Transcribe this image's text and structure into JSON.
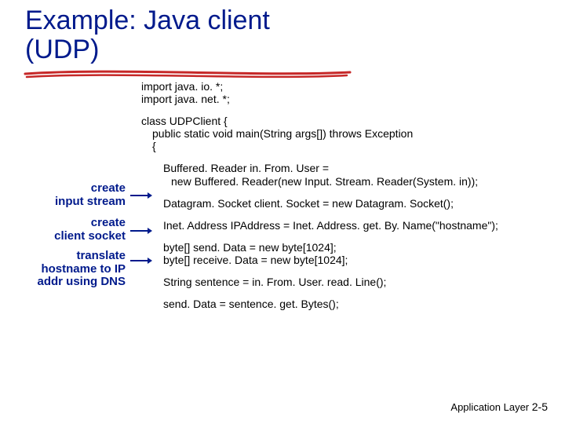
{
  "title_line1": "Example: Java client",
  "title_line2": "(UDP)",
  "code": {
    "l1": "import java. io. *;",
    "l2": "import java. net. *;",
    "l3": "class UDPClient {",
    "l4": "public static void main(String args[]) throws Exception",
    "l5": "{",
    "l6": "Buffered. Reader in. From. User =",
    "l7": "new Buffered. Reader(new Input. Stream. Reader(System. in));",
    "l8": "Datagram. Socket client. Socket = new Datagram. Socket();",
    "l9": "Inet. Address IPAddress = Inet. Address. get. By. Name(\"hostname\");",
    "l10": "byte[] send. Data = new byte[1024];",
    "l11": "byte[] receive. Data = new byte[1024];",
    "l12": "String sentence = in. From. User. read. Line();",
    "l13": "send. Data = sentence. get. Bytes();"
  },
  "annotations": {
    "a1_l1": "create",
    "a1_l2": "input stream",
    "a2_l1": "create",
    "a2_l2": "client socket",
    "a3_l1": "translate",
    "a3_l2": "hostname to IP",
    "a3_l3": "addr using DNS"
  },
  "footer_label": "Application Layer",
  "footer_page": "2-5"
}
